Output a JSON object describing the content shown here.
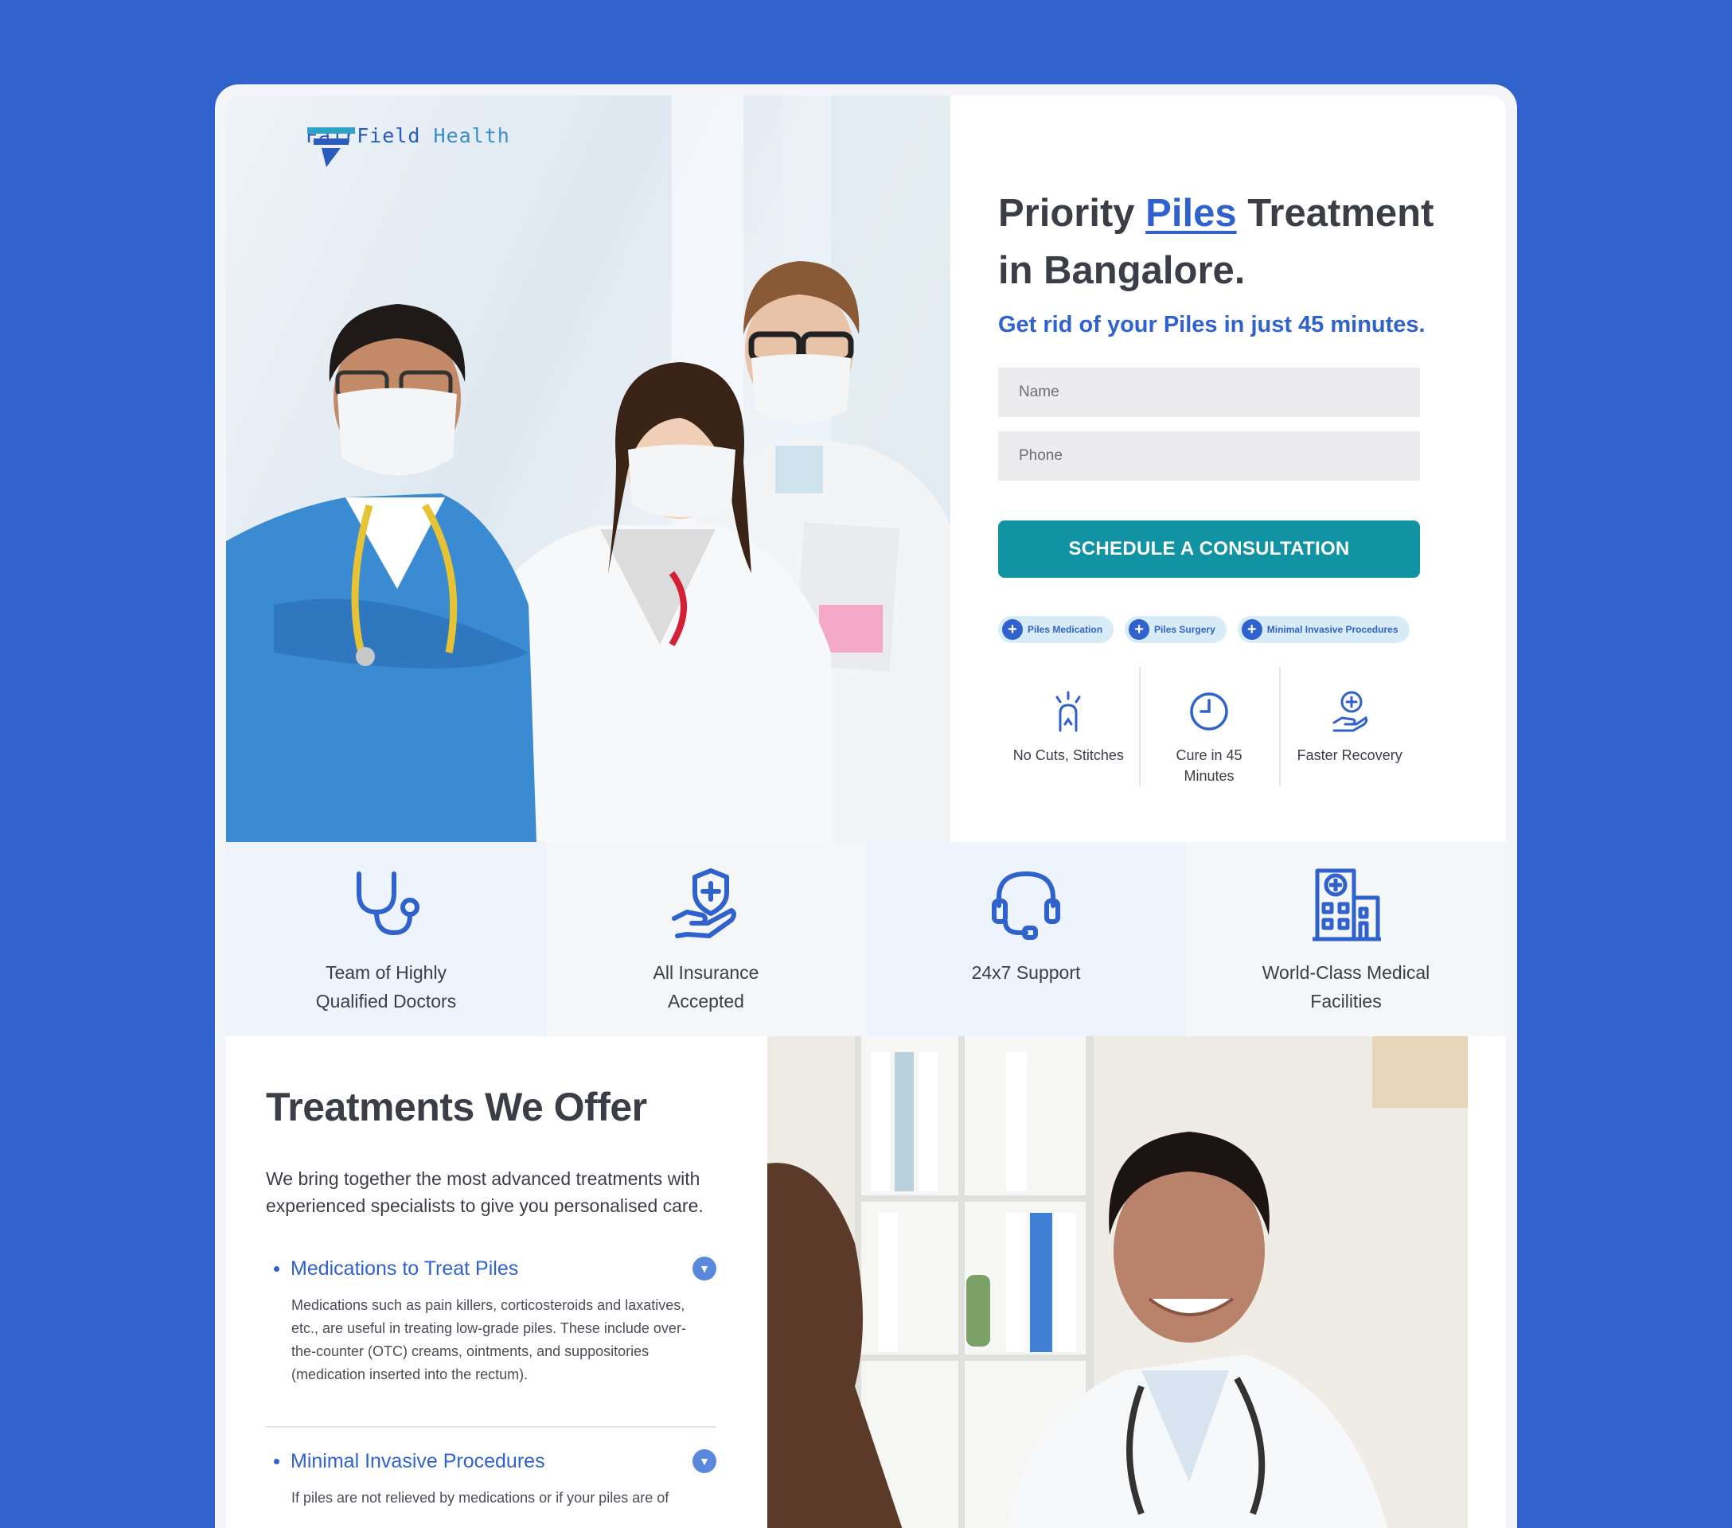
{
  "brand": {
    "name_part1": "FairField",
    "name_part2": "Health"
  },
  "hero": {
    "headline_prefix": "Priority ",
    "headline_highlight": "Piles",
    "headline_suffix": " Treatment in Bangalore.",
    "subheadline": "Get rid of your Piles in just 45 minutes.",
    "form": {
      "name_placeholder": "Name",
      "phone_placeholder": "Phone",
      "cta_label": "SCHEDULE A CONSULTATION"
    },
    "chips": [
      {
        "label": "Piles Medication",
        "icon": "plus-icon"
      },
      {
        "label": "Piles Surgery",
        "icon": "plus-icon"
      },
      {
        "label": "Minimal Invasive Procedures",
        "icon": "plus-icon"
      }
    ],
    "benefits": [
      {
        "label": "No Cuts, Stitches",
        "icon": "no-cuts-icon"
      },
      {
        "label": "Cure in 45 Minutes",
        "icon": "clock-icon"
      },
      {
        "label": "Faster Recovery",
        "icon": "hand-care-icon"
      }
    ]
  },
  "features": [
    {
      "label": "Team of Highly Qualified Doctors",
      "icon": "stethoscope-icon"
    },
    {
      "label": "All Insurance Accepted",
      "icon": "insurance-shield-icon"
    },
    {
      "label": "24x7 Support",
      "icon": "headset-icon"
    },
    {
      "label": "World-Class Medical Facilities",
      "icon": "hospital-building-icon"
    }
  ],
  "treatments": {
    "title": "Treatments We Offer",
    "intro": "We bring together the most advanced treatments with experienced specialists to give you personalised care.",
    "items": [
      {
        "title": "Medications to Treat Piles",
        "body": "Medications such as pain killers, corticosteroids and laxatives, etc., are useful in treating low-grade piles. These include over-the-counter (OTC) creams, ointments, and suppositories (medication inserted into the rectum)."
      },
      {
        "title": "Minimal Invasive Procedures",
        "body": "If piles are not relieved by medications or if your piles are of"
      }
    ]
  },
  "colors": {
    "brand_blue": "#2f62cc",
    "cta_teal": "#1293a4",
    "background": "#2f62cc"
  }
}
